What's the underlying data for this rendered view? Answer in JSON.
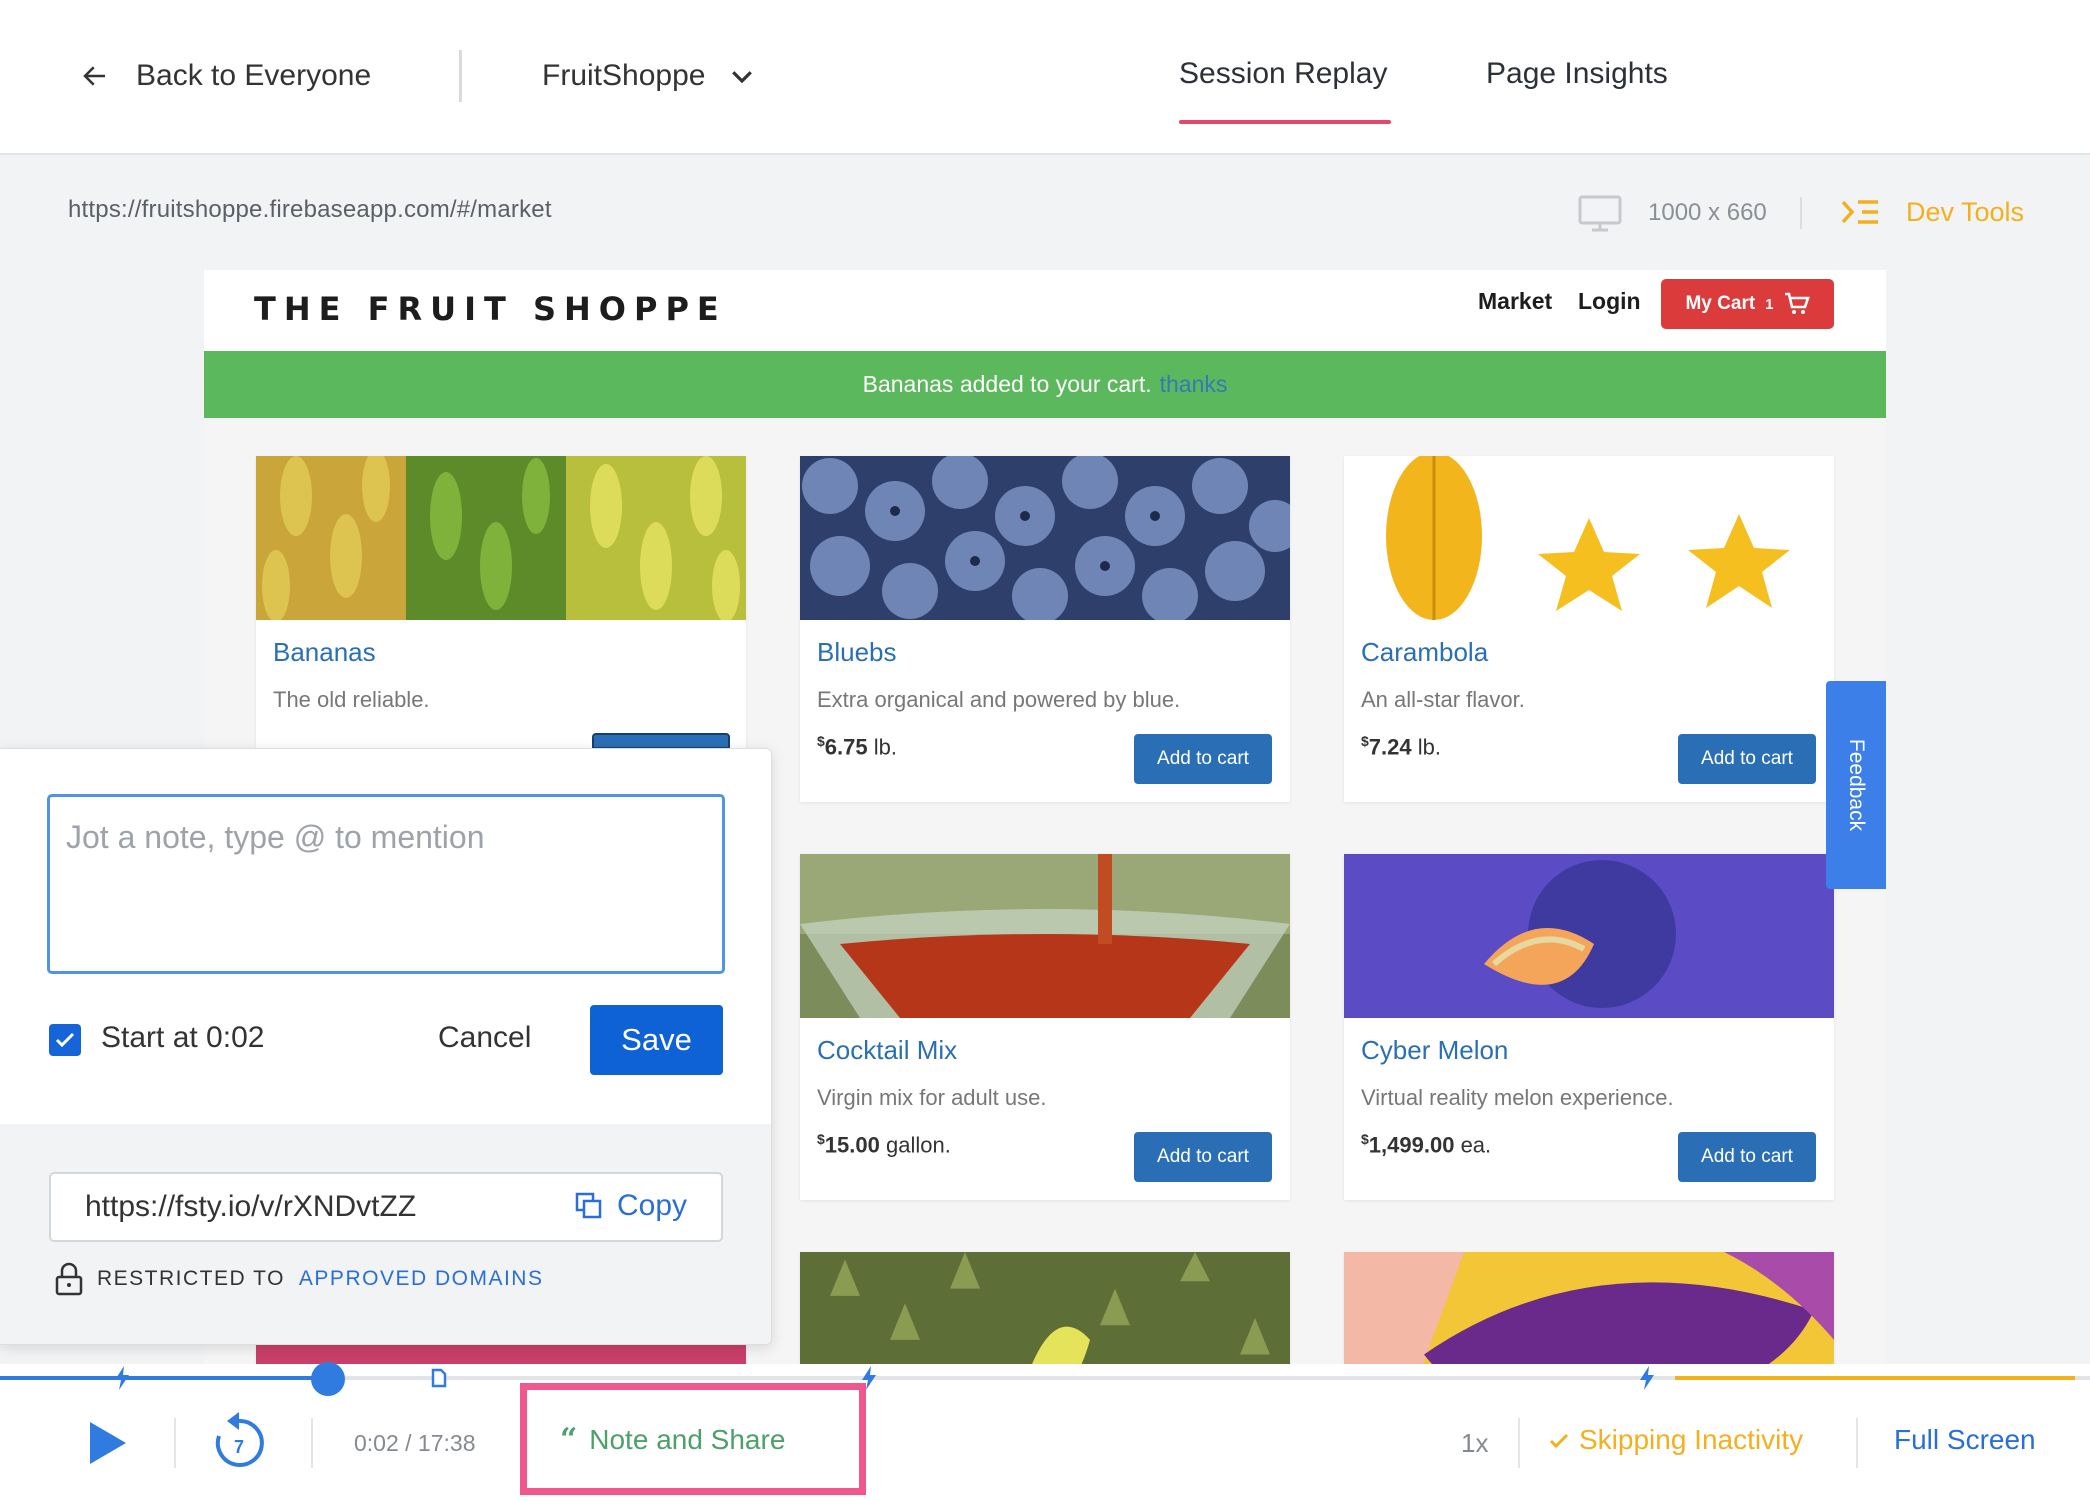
{
  "topnav": {
    "back_label": "Back to Everyone",
    "org_name": "FruitShoppe",
    "tabs": [
      {
        "label": "Session Replay",
        "active": true
      },
      {
        "label": "Page Insights",
        "active": false
      }
    ]
  },
  "viewer": {
    "url": "https://fruitshoppe.firebaseapp.com/#/market",
    "dimensions": "1000 x 660",
    "dev_tools_label": "Dev Tools"
  },
  "shop": {
    "logo": "THE FRUIT SHOPPE",
    "nav": [
      "Market",
      "Login"
    ],
    "cart_label": "My Cart",
    "cart_count": "1",
    "banner_text": "Bananas added to your cart.",
    "banner_link": "thanks",
    "feedback_label": "Feedback",
    "products": [
      {
        "name": "Bananas",
        "desc": "The old reliable.",
        "price": "",
        "unit": "",
        "button": ""
      },
      {
        "name": "Bluebs",
        "desc": "Extra organical and powered by blue.",
        "price": "6.75",
        "unit": "lb.",
        "button": "Add to cart"
      },
      {
        "name": "Carambola",
        "desc": "An all-star flavor.",
        "price": "7.24",
        "unit": "lb.",
        "button": "Add to cart"
      },
      {
        "name": "Cocktail Mix",
        "desc": "Virgin mix for adult use.",
        "price": "15.00",
        "unit": "gallon.",
        "button": "Add to cart"
      },
      {
        "name": "Cyber Melon",
        "desc": "Virtual reality melon experience.",
        "price": "1,499.00",
        "unit": "ea.",
        "button": "Add to cart"
      }
    ],
    "currency_symbol": "$"
  },
  "note": {
    "placeholder": "Jot a note, type @ to mention",
    "start_checked": true,
    "start_label": "Start at 0:02",
    "cancel_label": "Cancel",
    "save_label": "Save",
    "share_url": "https://fsty.io/v/rXNDvtZZ",
    "copy_label": "Copy",
    "restricted_prefix": "RESTRICTED TO",
    "restricted_link": "APPROVED DOMAINS"
  },
  "player": {
    "time": "0:02 / 17:38",
    "rewind_seconds": "7",
    "progress_fraction": 0.0019,
    "note_share_label": "Note and Share",
    "speed": "1x",
    "skipping_label": "Skipping Inactivity",
    "fullscreen_label": "Full Screen"
  },
  "colors": {
    "accent_pink": "#e6456e",
    "dev_tools_yellow": "#f2b01e",
    "link_blue": "#2a6fd6",
    "shop_green": "#5cb85c",
    "cart_red": "#dc3b3b",
    "note_share_green": "#4da06a"
  }
}
